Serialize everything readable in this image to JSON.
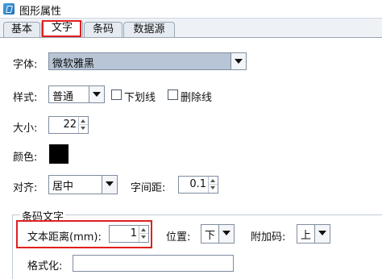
{
  "window": {
    "title": "图形属性",
    "icon": "app-icon"
  },
  "tabs": [
    {
      "label": "基本"
    },
    {
      "label": "文字",
      "active": true
    },
    {
      "label": "条码"
    },
    {
      "label": "数据源"
    }
  ],
  "font": {
    "label": "字体:",
    "value": "微软雅黑"
  },
  "style": {
    "label": "样式:",
    "value": "普通",
    "underline_label": "下划线",
    "strikethrough_label": "删除线",
    "underline_checked": false,
    "strikethrough_checked": false
  },
  "size": {
    "label": "大小:",
    "value": "22"
  },
  "color": {
    "label": "颜色:",
    "value": "#000000"
  },
  "align": {
    "label": "对齐:",
    "value": "居中",
    "spacing_label": "字间距:",
    "spacing_value": "0.1"
  },
  "barcode_text": {
    "group_title": "条码文字",
    "distance_label": "文本距离(mm):",
    "distance_value": "1",
    "position_label": "位置:",
    "position_value": "下",
    "addon_label": "附加码:",
    "addon_value": "上",
    "format_label": "格式化:",
    "format_value": ""
  },
  "colors": {
    "highlight": "#e02020",
    "panel_bg": "#ffffff",
    "window_bg": "#eef2f7",
    "font_combo_bg": "#b7c5d6"
  }
}
